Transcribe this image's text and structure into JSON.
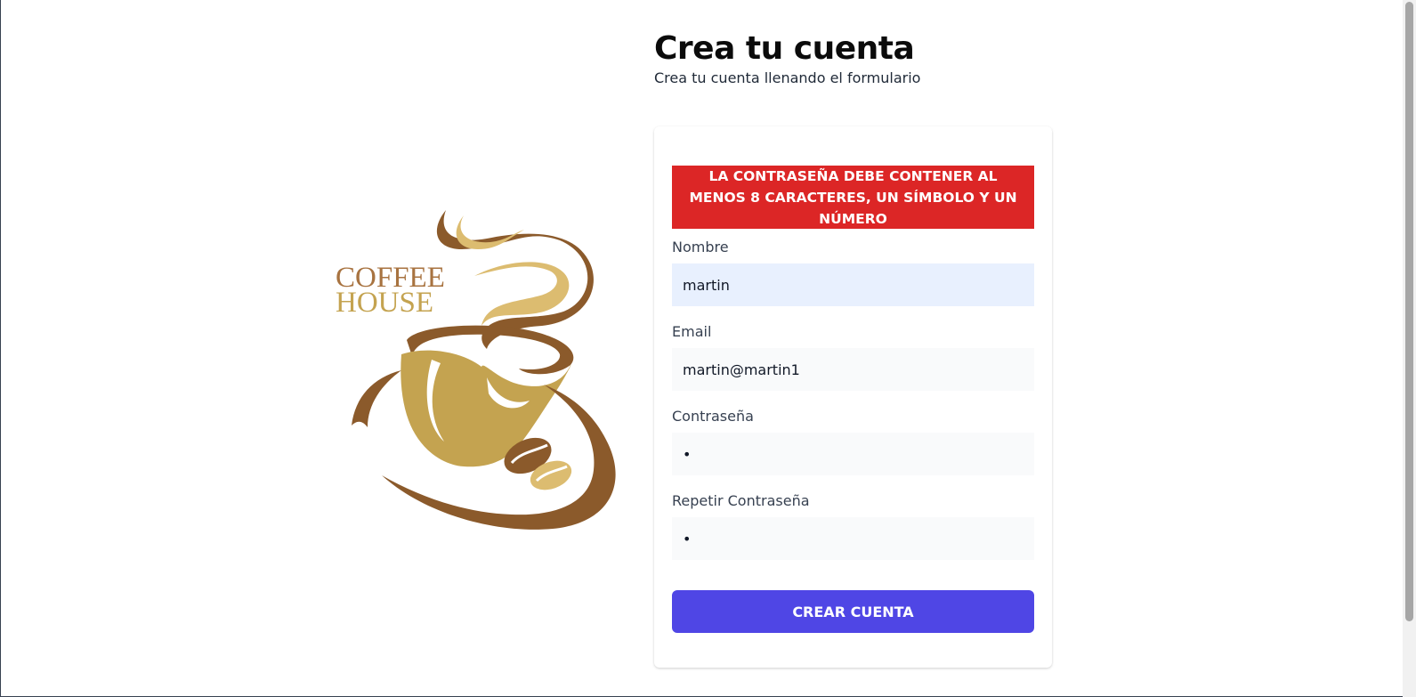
{
  "header": {
    "title": "Crea tu cuenta",
    "subtitle": "Crea tu cuenta llenando el formulario"
  },
  "logo": {
    "line1": "COFFEE",
    "line2": "HOUSE",
    "colors": {
      "brown": "#8b5a2b",
      "gold": "#c4a350",
      "light_gold": "#dcbc70"
    }
  },
  "form": {
    "alert": "LA CONTRASEÑA DEBE CONTENER AL MENOS 8 CARACTERES, UN SÍMBOLO Y UN NÚMERO",
    "fields": [
      {
        "label": "Nombre",
        "value": "martin",
        "type": "text"
      },
      {
        "label": "Email",
        "value": "martin@martin1",
        "type": "email"
      },
      {
        "label": "Contraseña",
        "value": "a",
        "type": "password"
      },
      {
        "label": "Repetir Contraseña",
        "value": "a",
        "type": "password"
      }
    ],
    "submit_label": "CREAR CUENTA"
  },
  "colors": {
    "alert_bg": "#dc2626",
    "button_bg": "#4f46e5",
    "input_bg": "#f9fafb",
    "autofill_bg": "#e8f0fe"
  }
}
